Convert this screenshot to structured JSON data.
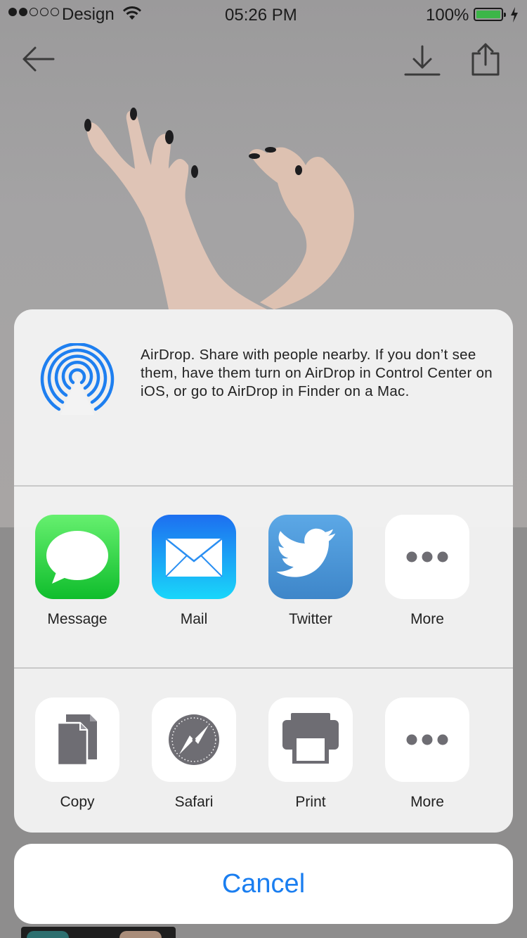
{
  "status_bar": {
    "carrier": "Design",
    "time": "05:26 PM",
    "battery_percent": "100%",
    "signal_bars_filled": 2,
    "signal_bars_total": 5,
    "battery_level": 1.0,
    "battery_color": "#3cb648"
  },
  "nav": {
    "back_icon": "arrow-left-icon",
    "download_icon": "download-icon",
    "share_icon": "share-icon"
  },
  "airdrop": {
    "icon": "airdrop-icon",
    "text": "AirDrop. Share with people nearby. If you don’t see them, have them turn on AirDrop in Control Center on iOS, or go to AirDrop in Finder on a Mac."
  },
  "share_apps": [
    {
      "label": "Message",
      "icon": "messages-icon"
    },
    {
      "label": "Mail",
      "icon": "mail-icon"
    },
    {
      "label": "Twitter",
      "icon": "twitter-icon"
    },
    {
      "label": "More",
      "icon": "more-icon"
    }
  ],
  "actions": [
    {
      "label": "Copy",
      "icon": "copy-icon"
    },
    {
      "label": "Safari",
      "icon": "safari-icon"
    },
    {
      "label": "Print",
      "icon": "print-icon"
    },
    {
      "label": "More",
      "icon": "more-icon"
    }
  ],
  "cancel_label": "Cancel",
  "colors": {
    "accent": "#1a7ef0",
    "airdrop_blue": "#1e7ff0",
    "action_icon_gray": "#6e6d73"
  }
}
